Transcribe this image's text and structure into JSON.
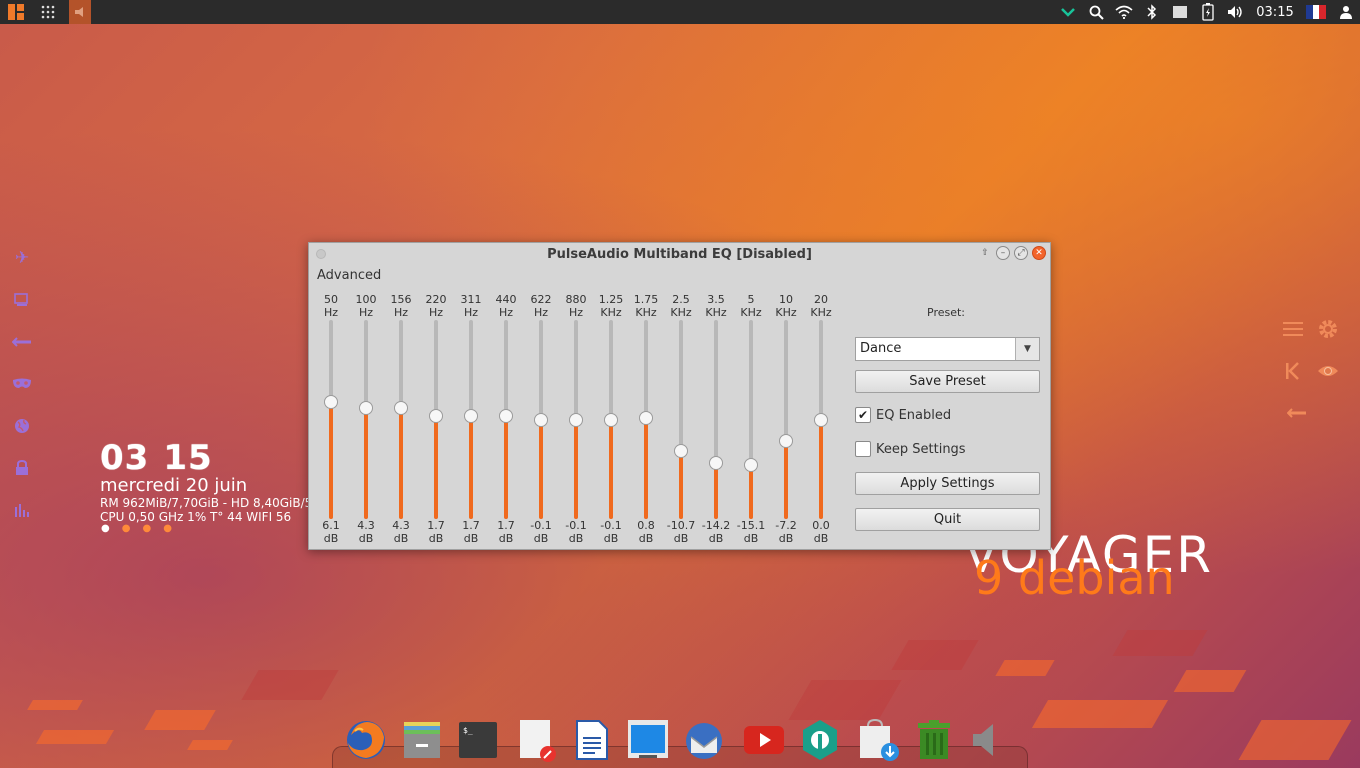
{
  "topbar": {
    "clock": "03:15",
    "tray_icons": [
      "chevron-down-icon",
      "search-icon",
      "wifi-icon",
      "bluetooth-icon",
      "screen-icon",
      "battery-icon",
      "volume-icon"
    ]
  },
  "conky": {
    "hour": "03",
    "minute": "15",
    "date": "mercredi 20 juin",
    "line1": "RM 962MiB/7,70GiB - HD 8,40GiB/5",
    "line2": "CPU 0,50 GHz 1% T° 44   WIFI 56"
  },
  "logo": {
    "top": "VOYAGER",
    "bottom": "9 debian"
  },
  "eq_window": {
    "title": "PulseAudio Multiband EQ [Disabled]",
    "menu": "Advanced",
    "bands": [
      {
        "freq": "50",
        "unit": "Hz",
        "db": "6.1",
        "db_unit": "dB",
        "level": 0.59
      },
      {
        "freq": "100",
        "unit": "Hz",
        "db": "4.3",
        "db_unit": "dB",
        "level": 0.56
      },
      {
        "freq": "156",
        "unit": "Hz",
        "db": "4.3",
        "db_unit": "dB",
        "level": 0.56
      },
      {
        "freq": "220",
        "unit": "Hz",
        "db": "1.7",
        "db_unit": "dB",
        "level": 0.52
      },
      {
        "freq": "311",
        "unit": "Hz",
        "db": "1.7",
        "db_unit": "dB",
        "level": 0.52
      },
      {
        "freq": "440",
        "unit": "Hz",
        "db": "1.7",
        "db_unit": "dB",
        "level": 0.52
      },
      {
        "freq": "622",
        "unit": "Hz",
        "db": "-0.1",
        "db_unit": "dB",
        "level": 0.5
      },
      {
        "freq": "880",
        "unit": "Hz",
        "db": "-0.1",
        "db_unit": "dB",
        "level": 0.5
      },
      {
        "freq": "1.25",
        "unit": "KHz",
        "db": "-0.1",
        "db_unit": "dB",
        "level": 0.5
      },
      {
        "freq": "1.75",
        "unit": "KHz",
        "db": "0.8",
        "db_unit": "dB",
        "level": 0.51
      },
      {
        "freq": "2.5",
        "unit": "KHz",
        "db": "-10.7",
        "db_unit": "dB",
        "level": 0.34
      },
      {
        "freq": "3.5",
        "unit": "KHz",
        "db": "-14.2",
        "db_unit": "dB",
        "level": 0.28
      },
      {
        "freq": "5",
        "unit": "KHz",
        "db": "-15.1",
        "db_unit": "dB",
        "level": 0.27
      },
      {
        "freq": "10",
        "unit": "KHz",
        "db": "-7.2",
        "db_unit": "dB",
        "level": 0.39
      },
      {
        "freq": "20",
        "unit": "KHz",
        "db": "0.0",
        "db_unit": "dB",
        "level": 0.5
      }
    ],
    "preset_label": "Preset:",
    "preset_value": "Dance",
    "save_preset": "Save Preset",
    "eq_enabled": "EQ Enabled",
    "keep_settings": "Keep Settings",
    "apply_settings": "Apply Settings",
    "quit": "Quit"
  },
  "dock": {
    "apps": [
      "firefox-icon",
      "file-manager-icon",
      "terminal-icon",
      "text-editor-icon",
      "writer-icon",
      "screen-icon",
      "thunderbird-icon",
      "youtube-icon",
      "software-icon",
      "downloads-icon",
      "trash-icon",
      "volume-icon"
    ]
  },
  "colors": {
    "accent": "#f06a1e",
    "panel": "#2b2b2b",
    "side_icons": "#9b6fd8",
    "right_icons": "#f08a5a"
  }
}
